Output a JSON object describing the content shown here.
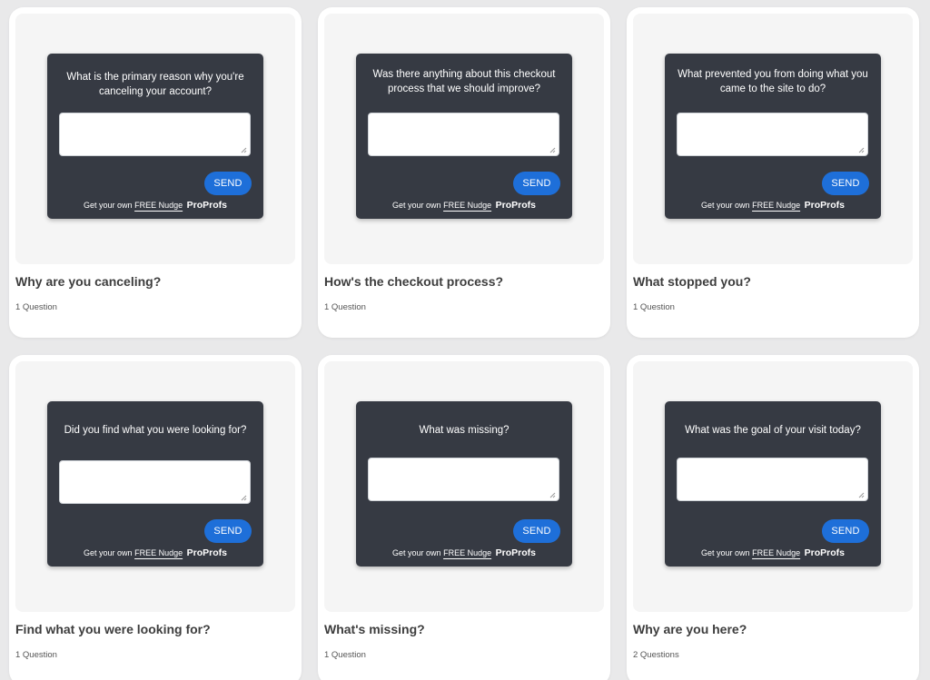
{
  "templates": [
    {
      "question": "What is the primary reason why you're canceling your account?",
      "title": "Why are you canceling?",
      "meta": "1 Question"
    },
    {
      "question": "Was there anything about this checkout process that we should improve?",
      "title": "How's the checkout process?",
      "meta": "1 Question"
    },
    {
      "question": "What prevented you from doing what you came to the site to do?",
      "title": "What stopped you?",
      "meta": "1 Question"
    },
    {
      "question": "Did you find what you were looking for?",
      "title": "Find what you were looking for?",
      "meta": "1 Question"
    },
    {
      "question": "What was missing?",
      "title": "What's missing?",
      "meta": "1 Question"
    },
    {
      "question": "What was the goal of your visit today?",
      "title": "Why are you here?",
      "meta": "2 Questions"
    }
  ],
  "widget": {
    "send_label": "SEND",
    "footer_prefix": "Get your own",
    "footer_link": "FREE Nudge",
    "footer_brand": "ProProfs"
  },
  "colors": {
    "widget_bg": "#363a43",
    "send_button": "#1e6fd9",
    "preview_bg": "#f5f5f5"
  },
  "icons": {
    "resize": "resize-grip-icon"
  }
}
